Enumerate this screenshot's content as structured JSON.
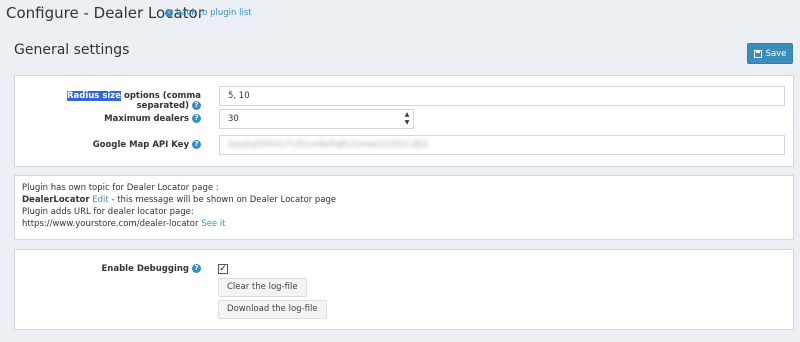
{
  "header": {
    "title": "Configure - Dealer Locator",
    "back_link": "back to plugin list"
  },
  "section": {
    "title": "General settings",
    "save_label": "Save"
  },
  "settings": {
    "radius": {
      "label_highlight": "Radius size",
      "label_rest": " options (comma separated)",
      "value": "5, 10"
    },
    "max_dealers": {
      "label": "Maximum dealers",
      "value": "30"
    },
    "api_key": {
      "label": "Google Map API Key",
      "value": "AIzaSyDh5Xx7Y2kLmNoPqRsTuVwXz12AbCdEA"
    }
  },
  "info": {
    "line1": "Plugin has own topic for Dealer Locator page :",
    "topic_name": "DealerLocator",
    "edit_link": "Edit",
    "line2_rest": " - this message will be shown on Dealer Locator page",
    "line3": "Plugin adds URL for dealer locator page:",
    "url": "https://www.yourstore.com/dealer-locator",
    "see_link": "See it"
  },
  "debug": {
    "label": "Enable Debugging",
    "checked": true,
    "clear_label": "Clear the log-file",
    "download_label": "Download the log-file"
  },
  "colors": {
    "accent": "#3c8dbc",
    "background": "#ecf0f5",
    "highlight": "#3367d6"
  }
}
